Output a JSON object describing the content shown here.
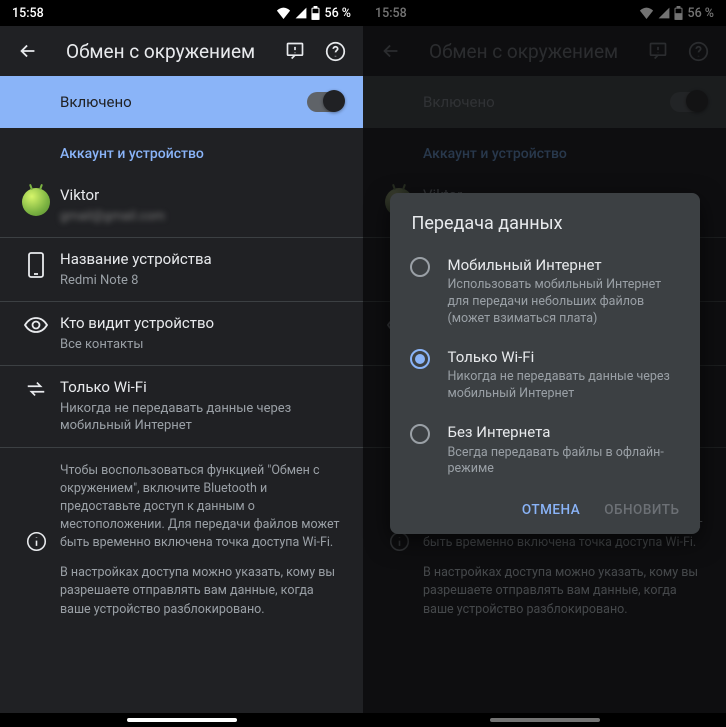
{
  "status": {
    "time": "15:58",
    "battery": "56 %"
  },
  "appbar": {
    "title": "Обмен с окружением"
  },
  "toggle": {
    "label": "Включено"
  },
  "section": {
    "header": "Аккаунт и устройство"
  },
  "items": {
    "account": {
      "title": "Viktor",
      "sub": "gmail@gmail.com"
    },
    "device": {
      "title": "Название устройства",
      "sub": "Redmi Note 8"
    },
    "visibility": {
      "title": "Кто видит устройство",
      "sub": "Все контакты"
    },
    "data": {
      "title": "Только Wi-Fi",
      "sub": "Никогда не передавать данные через мобильный Интернет"
    }
  },
  "info": {
    "p1": "Чтобы воспользоваться функцией \"Обмен с окружением\", включите Bluetooth и предоставьте доступ к данным о местоположении. Для передачи файлов может быть временно включена точка доступа Wi-Fi.",
    "p2": "В настройках доступа можно указать, кому вы разрешаете отправлять вам данные, когда ваше устройство разблокировано."
  },
  "dialog": {
    "title": "Передача данных",
    "options": [
      {
        "title": "Мобильный Интернет",
        "sub": "Использовать мобильный Интернет для передачи небольших файлов\n(может взиматься плата)",
        "selected": false
      },
      {
        "title": "Только Wi-Fi",
        "sub": "Никогда не передавать данные через мобильный Интернет",
        "selected": true
      },
      {
        "title": "Без Интернета",
        "sub": "Всегда передавать файлы в офлайн-режиме",
        "selected": false
      }
    ],
    "cancel": "ОТМЕНА",
    "confirm": "ОБНОВИТЬ"
  }
}
